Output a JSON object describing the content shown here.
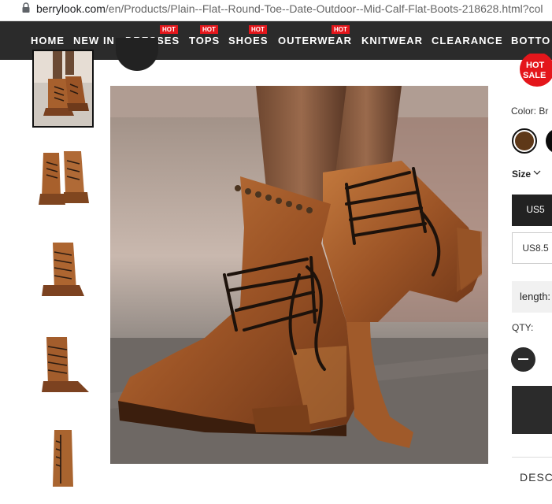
{
  "address_bar": {
    "host": "berrylook.com",
    "path": "/en/Products/Plain--Flat--Round-Toe--Date-Outdoor--Mid-Calf-Flat-Boots-218628.html?col"
  },
  "nav": {
    "items": [
      {
        "label": "HOME",
        "hot": ""
      },
      {
        "label": "NEW IN",
        "hot": ""
      },
      {
        "label": "DRESSES",
        "hot": "HOT"
      },
      {
        "label": "TOPS",
        "hot": "HOT"
      },
      {
        "label": "SHOES",
        "hot": "HOT"
      },
      {
        "label": "OUTERWEAR",
        "hot": "HOT"
      },
      {
        "label": "KNITWEAR",
        "hot": ""
      },
      {
        "label": "CLEARANCE",
        "hot": ""
      },
      {
        "label": "BOTTO",
        "hot": ""
      }
    ]
  },
  "product": {
    "hot_sale_badge": [
      "HOT",
      "SALE"
    ],
    "color_label": "Color:",
    "color_value": "Br",
    "size_label": "Size",
    "sizes": [
      "US5",
      "US8.5"
    ],
    "length_label": "length:",
    "qty_label": "QTY:",
    "description_tab": "DESC"
  },
  "colors": {
    "nav_bg": "#2b2b2b",
    "hot_red": "#e4161b",
    "leather": "#b06a36"
  }
}
